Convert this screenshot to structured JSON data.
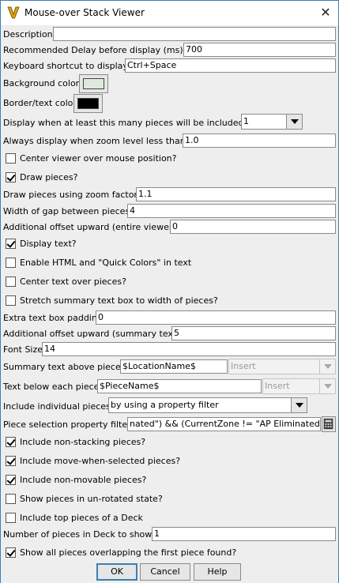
{
  "window": {
    "title": "Mouse-over Stack Viewer",
    "close_icon": "close-icon",
    "app_icon": "vassal-v-icon"
  },
  "fields": {
    "description": {
      "label": "Description",
      "value": ""
    },
    "delay": {
      "label": "Recommended Delay before display (ms)",
      "value": "700"
    },
    "shortcut": {
      "label": "Keyboard shortcut to display",
      "value": "Ctrl+Space"
    },
    "bg_color": {
      "label": "Background color",
      "color": "#dfe8dc"
    },
    "border_color": {
      "label": "Border/text color",
      "color": "#000000"
    },
    "min_pieces": {
      "label": "Display when at least this many pieces will be included",
      "value": "1"
    },
    "zoom_level": {
      "label": "Always display when zoom level less than",
      "value": "1.0"
    },
    "center_viewer": {
      "label": "Center viewer over mouse position?",
      "checked": false
    },
    "draw_pieces": {
      "label": "Draw pieces?",
      "checked": true
    },
    "zoom_factor": {
      "label": "Draw pieces using zoom factor",
      "value": "1.1"
    },
    "gap_width": {
      "label": "Width of gap between pieces",
      "value": "4"
    },
    "offset_viewer": {
      "label": "Additional offset upward (entire viewer)",
      "value": "0"
    },
    "display_text": {
      "label": "Display text?",
      "checked": true
    },
    "enable_html": {
      "label": "Enable HTML and \"Quick Colors\" in text",
      "checked": false
    },
    "center_text": {
      "label": "Center text over pieces?",
      "checked": false
    },
    "stretch_summary": {
      "label": "Stretch summary text box to width of pieces?",
      "checked": false
    },
    "text_padding": {
      "label": "Extra text box padding",
      "value": "0"
    },
    "offset_summary": {
      "label": "Additional offset upward (summary text)",
      "value": "5"
    },
    "font_size": {
      "label": "Font Size",
      "value": "14"
    },
    "summary_text": {
      "label": "Summary text above pieces",
      "value": "$LocationName$",
      "insert": "Insert"
    },
    "piece_text": {
      "label": "Text below each piece",
      "value": "$PieceName$",
      "insert": "Insert"
    },
    "include_individual": {
      "label": "Include individual pieces",
      "value": "by using a property filter"
    },
    "property_filter": {
      "label": "Piece selection property filter",
      "value": "nated\") && (CurrentZone != \"AP Eliminated\")}",
      "calc_icon": "calculator-icon"
    },
    "non_stacking": {
      "label": "Include non-stacking pieces?",
      "checked": true
    },
    "move_when_selected": {
      "label": "Include move-when-selected pieces?",
      "checked": true
    },
    "non_movable": {
      "label": "Include non-movable pieces?",
      "checked": true
    },
    "unrotated": {
      "label": "Show pieces in un-rotated state?",
      "checked": false
    },
    "top_of_deck": {
      "label": "Include top pieces of a Deck",
      "checked": false
    },
    "deck_count": {
      "label": "Number of pieces in Deck to show",
      "value": "1"
    },
    "show_overlapping": {
      "label": "Show all pieces overlapping the first piece found?",
      "checked": true
    }
  },
  "buttons": {
    "ok": "OK",
    "cancel": "Cancel",
    "help": "Help"
  }
}
